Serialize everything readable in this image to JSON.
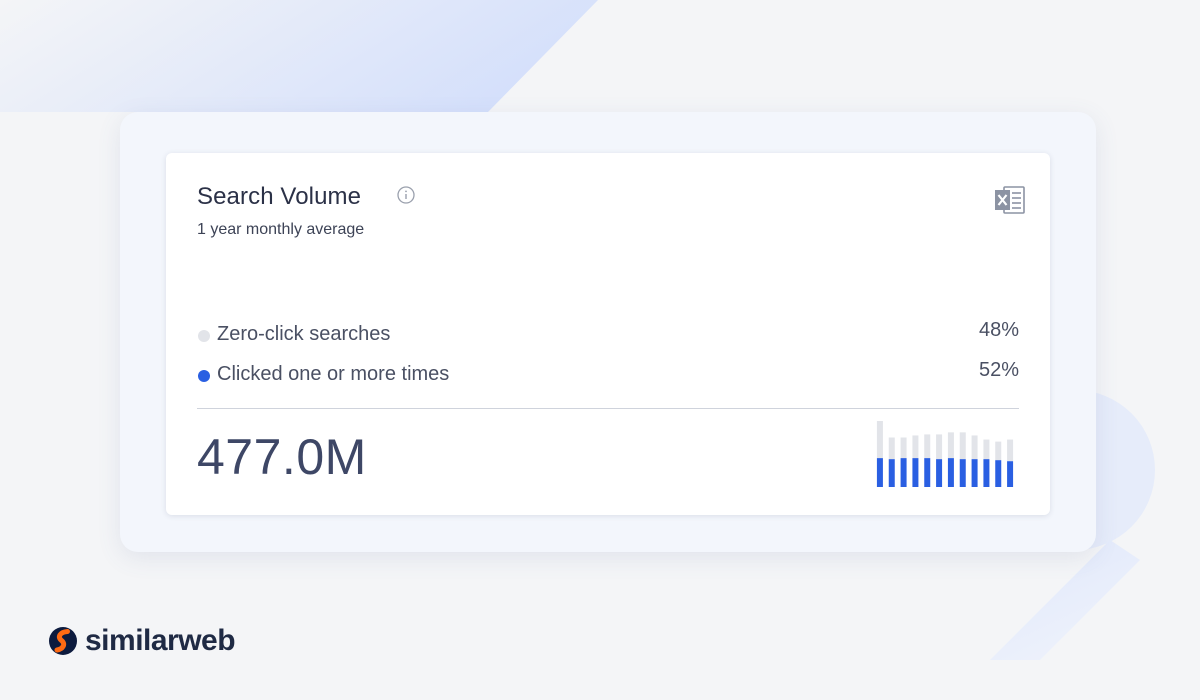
{
  "card": {
    "title": "Search Volume",
    "subtitle": "1 year monthly average",
    "info_icon": "info-icon",
    "export_icon": "excel-icon"
  },
  "legend": [
    {
      "label": "Zero-click searches",
      "value": "48%",
      "color": "#e2e4e9"
    },
    {
      "label": "Clicked one or more times",
      "value": "52%",
      "color": "#2a5fe2"
    }
  ],
  "total": "477.0M",
  "brand": {
    "name": "similarweb",
    "logo_colors": [
      "#0d1b3e",
      "#ff6a13"
    ]
  },
  "colors": {
    "accent": "#2a5fe2",
    "zero_click": "#e2e4e9"
  },
  "chart_data": {
    "type": "bar",
    "stacked": true,
    "series": [
      {
        "name": "Clicked one or more times",
        "values": [
          28,
          27,
          28,
          28,
          28,
          27,
          28,
          27,
          27,
          27,
          26,
          25
        ]
      },
      {
        "name": "Zero-click searches",
        "values": [
          36,
          21,
          20,
          22,
          23,
          24,
          25,
          26,
          23,
          19,
          18,
          21
        ]
      }
    ],
    "ylim": [
      0,
      64
    ],
    "grid": false,
    "title": "",
    "xlabel": "",
    "ylabel": ""
  }
}
